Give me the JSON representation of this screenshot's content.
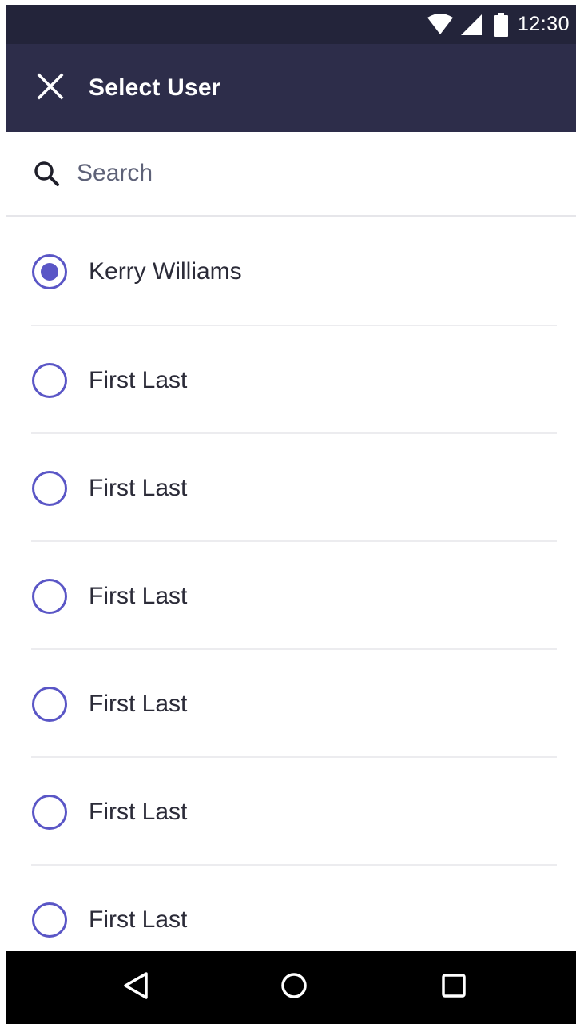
{
  "status_bar": {
    "time": "12:30",
    "icons": [
      "wifi-icon",
      "signal-icon",
      "battery-icon"
    ]
  },
  "app_bar": {
    "title": "Select User",
    "close_icon": "close-icon"
  },
  "search": {
    "placeholder": "Search",
    "value": "",
    "icon": "search-icon"
  },
  "users": [
    {
      "name": "Kerry Williams",
      "selected": true
    },
    {
      "name": "First Last",
      "selected": false
    },
    {
      "name": "First Last",
      "selected": false
    },
    {
      "name": "First Last",
      "selected": false
    },
    {
      "name": "First Last",
      "selected": false
    },
    {
      "name": "First Last",
      "selected": false
    },
    {
      "name": "First Last",
      "selected": false
    }
  ],
  "nav_bar": {
    "buttons": [
      "back-icon",
      "home-icon",
      "recents-icon"
    ]
  },
  "colors": {
    "status_bar_bg": "#23243a",
    "app_bar_bg": "#2d2d4a",
    "accent": "#5a56c6",
    "nav_bar_bg": "#000000"
  }
}
